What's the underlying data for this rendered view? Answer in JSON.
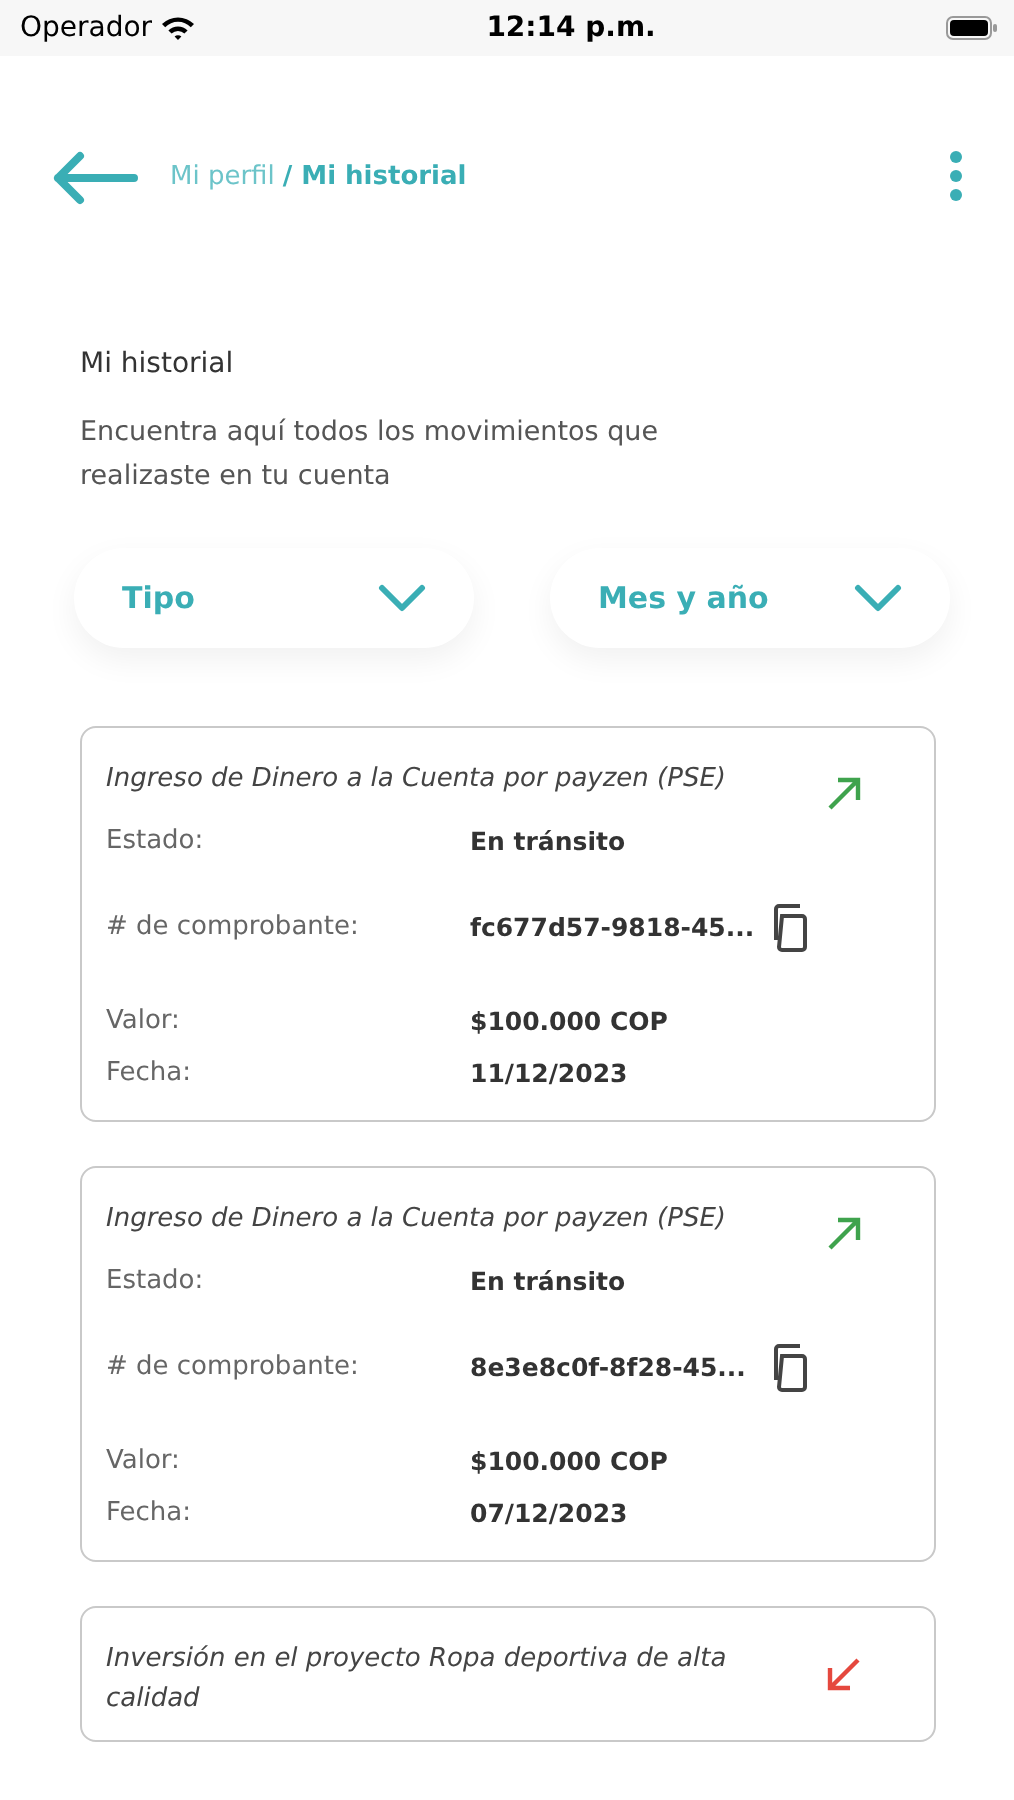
{
  "status_bar": {
    "carrier": "Operador",
    "time": "12:14 p.m."
  },
  "breadcrumb": {
    "parent": "Mi perfil",
    "current": "/ Mi historial"
  },
  "section": {
    "title": "Mi historial",
    "description": "Encuentra aquí todos los movimientos que realizaste en tu cuenta"
  },
  "filters": [
    {
      "label": "Tipo"
    },
    {
      "label": "Mes y año"
    }
  ],
  "movements": [
    {
      "title": "Ingreso de Dinero a la Cuenta por payzen (PSE)",
      "kind": "incoming",
      "fields": [
        {
          "label": "Estado:",
          "value": "En tránsito"
        },
        {
          "label": "# de comprobante:",
          "value": "fc677d57-9818-45...",
          "copy": true
        },
        {
          "label": "Valor:",
          "value": "$100.000 COP"
        },
        {
          "label": "Fecha:",
          "value": "11/12/2023"
        }
      ]
    },
    {
      "title": "Ingreso de Dinero a la Cuenta por payzen (PSE)",
      "kind": "incoming",
      "fields": [
        {
          "label": "Estado:",
          "value": "En tránsito"
        },
        {
          "label": "# de comprobante:",
          "value": "8e3e8c0f-8f28-45...",
          "copy": true
        },
        {
          "label": "Valor:",
          "value": "$100.000 COP"
        },
        {
          "label": "Fecha:",
          "value": "07/12/2023"
        }
      ]
    },
    {
      "title": "Inversión en el proyecto Ropa deportiva de alta calidad",
      "kind": "outgoing"
    }
  ]
}
